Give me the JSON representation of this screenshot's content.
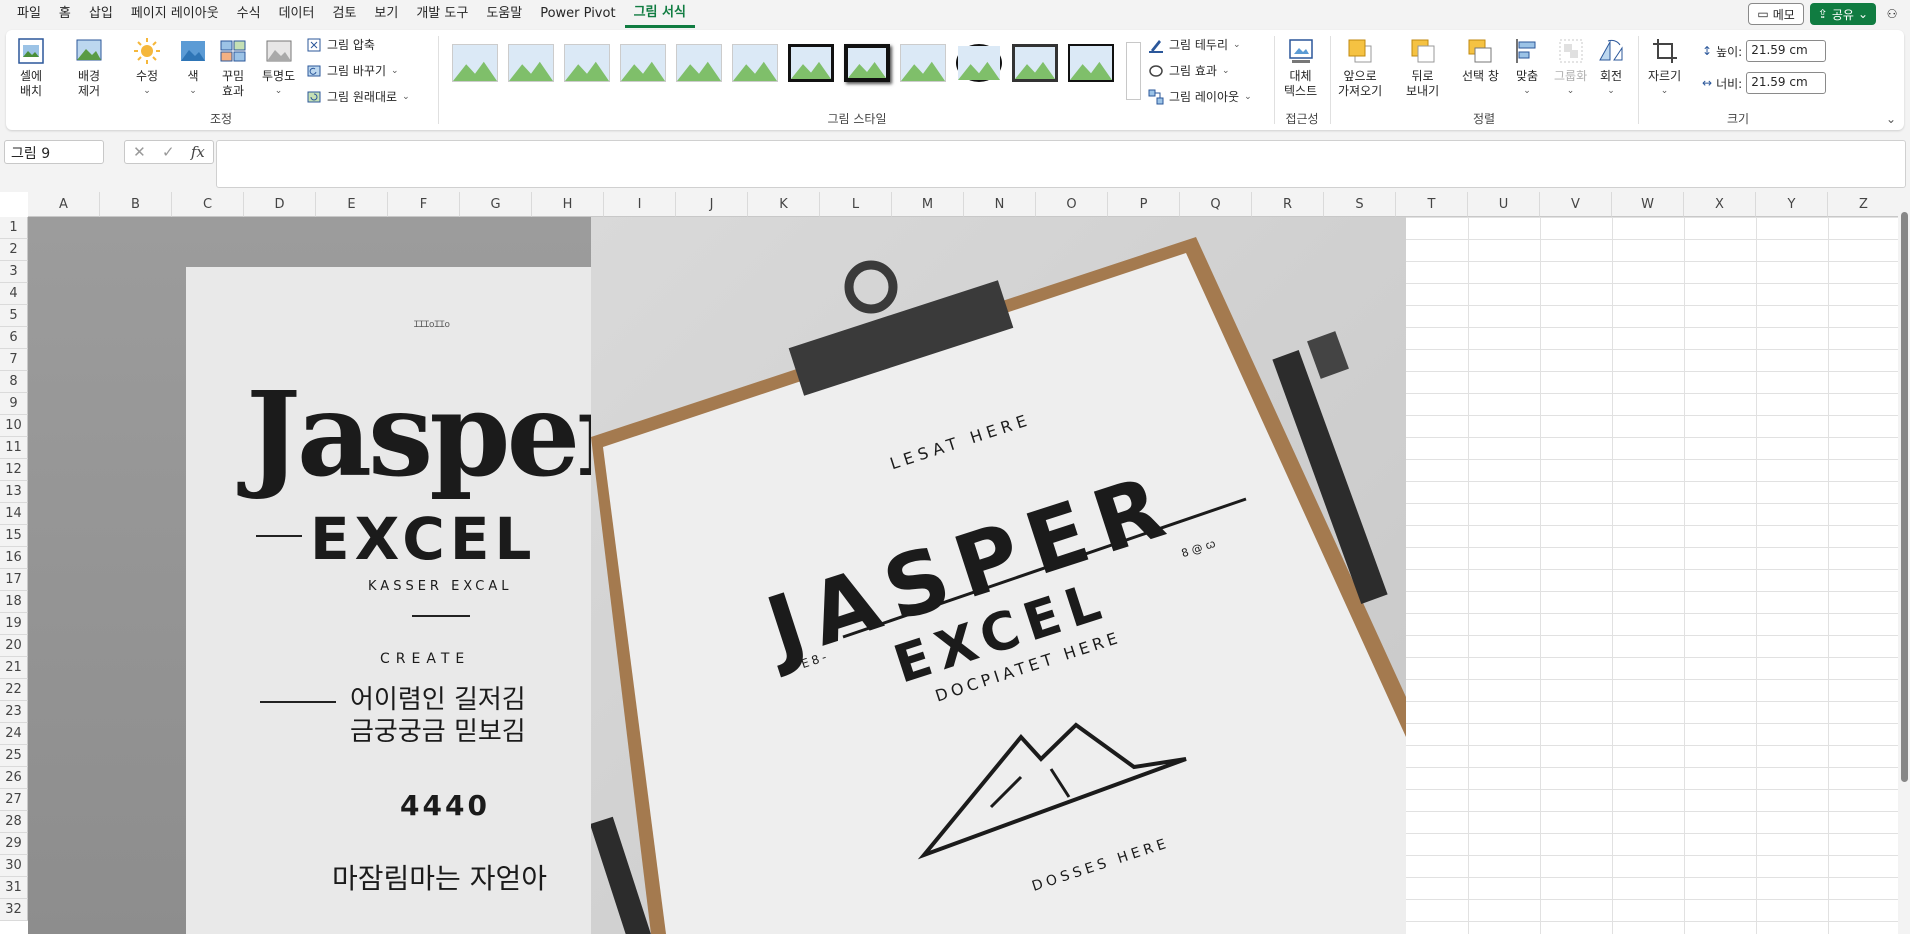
{
  "menu": {
    "items": [
      "파일",
      "홈",
      "삽입",
      "페이지 레이아웃",
      "수식",
      "데이터",
      "검토",
      "보기",
      "개발 도구",
      "도움말",
      "Power Pivot",
      "그림 서식"
    ],
    "active_index": 11,
    "memo_label": "메모",
    "share_label": "공유"
  },
  "ribbon": {
    "adjust": {
      "label": "조정",
      "cell_fit": "셀에\n배치",
      "remove_bg": "배경\n제거",
      "corrections": "수정",
      "color": "색",
      "artistic": "꾸밈\n효과",
      "transparency": "투명도",
      "compress": "그림 압축",
      "change": "그림 바꾸기",
      "reset": "그림 원래대로"
    },
    "styles": {
      "label": "그림 스타일",
      "border": "그림 테두리",
      "effects": "그림 효과",
      "layout": "그림 레이아웃"
    },
    "accessibility": {
      "label": "접근성",
      "alt_text": "대체\n텍스트"
    },
    "arrange": {
      "label": "정렬",
      "bring_forward": "앞으로\n가져오기",
      "send_backward": "뒤로\n보내기",
      "selection_pane": "선택 창",
      "align": "맞춤",
      "group": "그룹화",
      "rotate": "회전"
    },
    "size": {
      "label": "크기",
      "crop": "자르기",
      "height_label": "높이:",
      "height_value": "21.59 cm",
      "width_label": "너비:",
      "width_value": "21.59 cm"
    }
  },
  "formula_bar": {
    "name_box": "그림 9",
    "fx": "fx",
    "formula": ""
  },
  "grid": {
    "columns": [
      "A",
      "B",
      "C",
      "D",
      "E",
      "F",
      "G",
      "H",
      "I",
      "J",
      "K",
      "L",
      "M",
      "N",
      "O",
      "P",
      "Q",
      "R",
      "S",
      "T",
      "U",
      "V",
      "W",
      "X",
      "Y",
      "Z"
    ],
    "rows": [
      "1",
      "2",
      "3",
      "4",
      "5",
      "6",
      "7",
      "8",
      "9",
      "10",
      "11",
      "12",
      "13",
      "14",
      "15",
      "16",
      "17",
      "18",
      "19",
      "20",
      "21",
      "22",
      "23",
      "24",
      "25",
      "26",
      "27",
      "28",
      "29",
      "30",
      "31",
      "32"
    ]
  },
  "picture": {
    "left": {
      "top_small": "ꞮꞮꞮ꧐ꞮꞮ꧐",
      "title": "Jasper",
      "subtitle": "EXCEL",
      "tagline": "KASSER EXCAL",
      "create": "CREATE",
      "korean1": "어이렴인 길저김",
      "korean2": "금궁궁금 믿보김",
      "number": "4440",
      "korean3": "마잠림마는 자얻아"
    },
    "right": {
      "top_text": "LESAT HERE",
      "title": "JASPER",
      "subtitle": "EXCEL",
      "side_left": "E8-",
      "tagline": "DOCPIATET HERE",
      "side_right": "8 @ ꞷ",
      "bottom_text": "DOSSES HERE"
    }
  }
}
